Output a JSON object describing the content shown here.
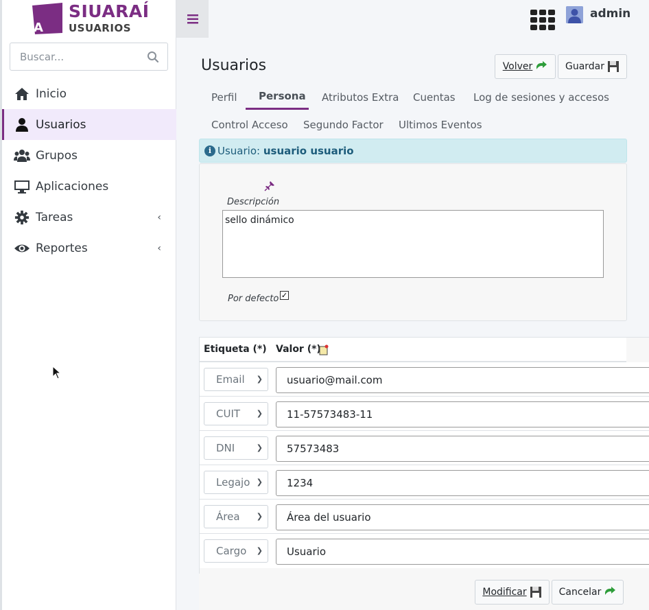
{
  "app": {
    "brand": "SIUARAÍ",
    "subtitle": "USUARIOS",
    "logo_letter": "A"
  },
  "sidebar": {
    "search_placeholder": "Buscar...",
    "items": [
      {
        "label": "Inicio",
        "icon": "home-icon",
        "active": false
      },
      {
        "label": "Usuarios",
        "icon": "user-icon",
        "active": true
      },
      {
        "label": "Grupos",
        "icon": "users-icon",
        "active": false
      },
      {
        "label": "Aplicaciones",
        "icon": "desktop-icon",
        "active": false
      },
      {
        "label": "Tareas",
        "icon": "gear-icon",
        "active": false,
        "chevron": "‹"
      },
      {
        "label": "Reportes",
        "icon": "eye-icon",
        "active": false,
        "chevron": "‹"
      }
    ]
  },
  "topbar": {
    "username": "admin"
  },
  "page": {
    "title": "Usuarios",
    "back_button": "Volver",
    "save_button": "Guardar",
    "tabs": [
      "Perfil",
      "Persona",
      "Atributos Extra",
      "Cuentas",
      "Log de sesiones y accesos",
      "Control Acceso",
      "Segundo Factor",
      "Ultimos Eventos"
    ],
    "active_tab": "Persona"
  },
  "info": {
    "prefix": "Usuario:",
    "user": "usuario usuario"
  },
  "description": {
    "label": "Descripción",
    "value": "sello dinámico",
    "default_label": "Por defecto",
    "default_checked": true
  },
  "attributes": {
    "header_label": "Etiqueta (*)",
    "header_value": "Valor (*)",
    "rows": [
      {
        "label": "Email",
        "value": "usuario@mail.com"
      },
      {
        "label": "CUIT",
        "value": "11-57573483-11"
      },
      {
        "label": "DNI",
        "value": "57573483"
      },
      {
        "label": "Legajo",
        "value": "1234"
      },
      {
        "label": "Área",
        "value": "Área del usuario"
      },
      {
        "label": "Cargo",
        "value": "Usuario"
      }
    ]
  },
  "footer": {
    "modify_button": "Modificar",
    "cancel_button": "Cancelar"
  },
  "colors": {
    "brand": "#7b2d83",
    "info_bg": "#d1ecf1",
    "save_green": "#2e9d3a"
  }
}
